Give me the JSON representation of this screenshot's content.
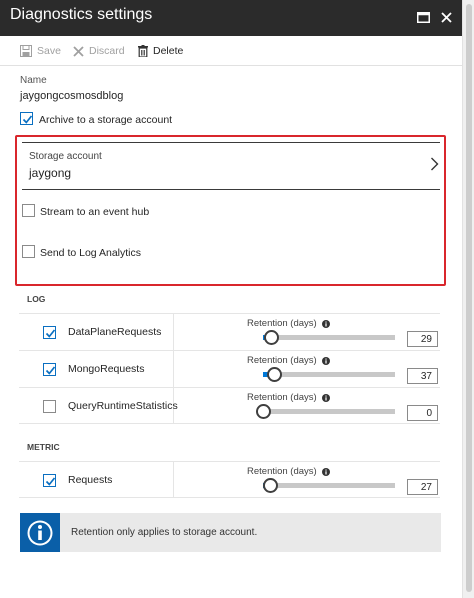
{
  "header": {
    "title": "Diagnostics settings"
  },
  "toolbar": {
    "save": "Save",
    "discard": "Discard",
    "delete": "Delete"
  },
  "name": {
    "label": "Name",
    "value": "jaygongcosmosdblog"
  },
  "archive": {
    "label": "Archive to a storage account",
    "checked": true
  },
  "storage": {
    "label": "Storage account",
    "value": "jaygong"
  },
  "event_hub": {
    "label": "Stream to an event hub",
    "checked": false
  },
  "log_analytics": {
    "label": "Send to Log Analytics",
    "checked": false
  },
  "log": {
    "heading": "LOG",
    "rows": [
      {
        "label": "DataPlaneRequests",
        "checked": true,
        "retention_label": "Retention (days)",
        "retention_days": "29",
        "slider_fraction": 0.06
      },
      {
        "label": "MongoRequests",
        "checked": true,
        "retention_label": "Retention (days)",
        "retention_days": "37",
        "slider_fraction": 0.08
      },
      {
        "label": "QueryRuntimeStatistics",
        "checked": false,
        "retention_label": "Retention (days)",
        "retention_days": "0",
        "slider_fraction": 0.0
      }
    ]
  },
  "metric": {
    "heading": "METRIC",
    "rows": [
      {
        "label": "Requests",
        "checked": true,
        "retention_label": "Retention (days)",
        "retention_days": "27",
        "slider_fraction": 0.05
      }
    ]
  },
  "info": {
    "text": "Retention only applies to storage account."
  },
  "colors": {
    "accent": "#0078d7",
    "highlight_border": "#d9262c",
    "title_bar": "#2b2b2b",
    "info_icon_bg": "#0a5fa8"
  },
  "icons": {
    "maximize": "maximize-icon",
    "close": "close-icon",
    "save": "save-icon",
    "discard": "discard-icon",
    "delete": "trash-icon",
    "info": "info-icon",
    "chevron": "chevron-right-icon"
  }
}
